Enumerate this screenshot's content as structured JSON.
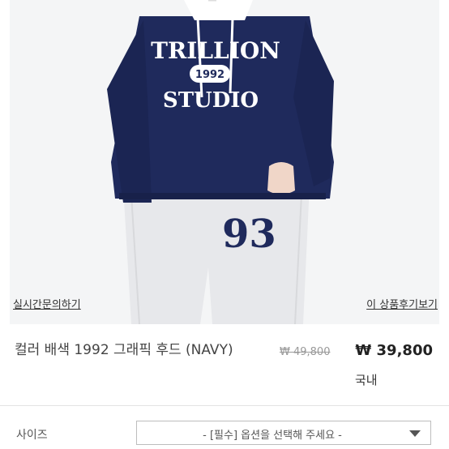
{
  "photo": {
    "shirt_print_top": "TRILLION",
    "shirt_print_year": "1992",
    "shirt_print_bottom": "STUDIO",
    "pants_print": "93",
    "colors": {
      "hoodie": "#1f2a5c",
      "pants": "#e6e7ea",
      "background": "#f4f5f6"
    }
  },
  "links": {
    "inquiry": "실시간문의하기",
    "reviews": "이 상품후기보기"
  },
  "product": {
    "name": "컬러 배색 1992 그래픽 후드 (NAVY)",
    "original_price": "₩ 49,800",
    "price": "₩ 39,800",
    "origin": "국내"
  },
  "options": {
    "label": "사이즈",
    "placeholder": "- [필수] 옵션을 선택해 주세요 -"
  }
}
